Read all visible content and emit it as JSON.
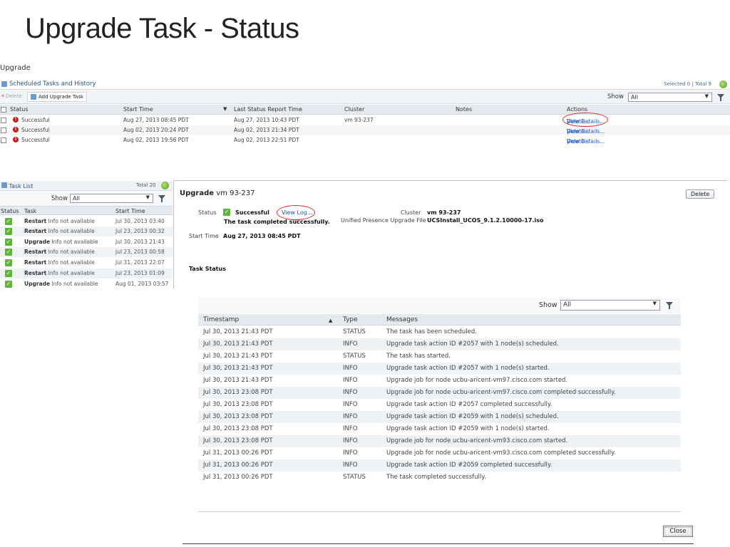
{
  "slide_title": "Upgrade Task - Status",
  "breadcrumb": "Upgrade",
  "scheduled": {
    "title": "Scheduled Tasks and History",
    "counts": "Selected 0 | Total 9",
    "delete_label": "Delete",
    "add_label": "Add Upgrade Task",
    "show_label": "Show",
    "show_value": "All",
    "columns": [
      "Status",
      "Start Time",
      "Last Status Report Time",
      "Cluster",
      "Notes",
      "Actions"
    ],
    "rows": [
      {
        "status": "Successful",
        "start": "Aug 27, 2013 08:45 PDT",
        "last": "Aug 27, 2013 10:43 PDT",
        "cluster": "vm 93-237",
        "notes": "",
        "view": "View Details...",
        "delete": "Delete..."
      },
      {
        "status": "Successful",
        "start": "Aug 02, 2013 20:24 PDT",
        "last": "Aug 02, 2013 21:34 PDT",
        "cluster": "",
        "notes": "",
        "view": "View Details...",
        "delete": "Delete..."
      },
      {
        "status": "Successful",
        "start": "Aug 02, 2013 19:56 PDT",
        "last": "Aug 02, 2013 22:51 PDT",
        "cluster": "",
        "notes": "",
        "view": "View Details...",
        "delete": "Delete..."
      }
    ]
  },
  "task_list": {
    "title": "Task List",
    "total": "Total 20",
    "show_label": "Show",
    "show_value": "All",
    "columns": [
      "Status",
      "Task",
      "Start Time"
    ],
    "rows": [
      {
        "task": "Restart",
        "info": "Info not available",
        "start": "Jul 30, 2013 03:40"
      },
      {
        "task": "Restart",
        "info": "Info not available",
        "start": "Jul 23, 2013 00:32"
      },
      {
        "task": "Upgrade",
        "info": "Info not available",
        "start": "Jul 30, 2013 21:43"
      },
      {
        "task": "Restart",
        "info": "Info not available",
        "start": "Jul 23, 2013 00:58"
      },
      {
        "task": "Restart",
        "info": "Info not available",
        "start": "Jul 31, 2013 22:07"
      },
      {
        "task": "Restart",
        "info": "Info not available",
        "start": "Jul 23, 2013 01:09"
      },
      {
        "task": "Upgrade",
        "info": "Info not available",
        "start": "Aug 01, 2013 03:57"
      }
    ]
  },
  "detail": {
    "title_bold": "Upgrade",
    "title_rest": " vm 93-237",
    "delete_label": "Delete",
    "status_label": "Status",
    "status_value": "Successful",
    "view_log": "View Log...",
    "status_message": "The task completed successfully.",
    "cluster_label": "Cluster",
    "cluster_value": "vm 93-237",
    "file_label": "Unified Presence Upgrade File",
    "file_value": "UCSInstall_UCOS_9.1.2.10000-17.iso",
    "start_label": "Start Time",
    "start_value": "Aug 27, 2013 08:45 PDT",
    "task_status_label": "Task Status"
  },
  "log": {
    "show_label": "Show",
    "show_value": "All",
    "columns": [
      "Timestamp",
      "Type",
      "Messages"
    ],
    "rows": [
      {
        "ts": "Jul 30, 2013 21:43 PDT",
        "type": "STATUS",
        "msg": "The task has been scheduled."
      },
      {
        "ts": "Jul 30, 2013 21:43 PDT",
        "type": "INFO",
        "msg": "Upgrade task action ID #2057 with 1 node(s) scheduled."
      },
      {
        "ts": "Jul 30, 2013 21:43 PDT",
        "type": "STATUS",
        "msg": "The task has started."
      },
      {
        "ts": "Jul 30, 2013 21:43 PDT",
        "type": "INFO",
        "msg": "Upgrade task action ID #2057 with 1 node(s) started."
      },
      {
        "ts": "Jul 30, 2013 21:43 PDT",
        "type": "INFO",
        "msg": "Upgrade job for node ucbu-aricent-vm97.cisco.com started."
      },
      {
        "ts": "Jul 30, 2013 23:08 PDT",
        "type": "INFO",
        "msg": "Upgrade job for node ucbu-aricent-vm97.cisco.com completed successfully."
      },
      {
        "ts": "Jul 30, 2013 23:08 PDT",
        "type": "INFO",
        "msg": "Upgrade task action ID #2057 completed successfully."
      },
      {
        "ts": "Jul 30, 2013 23:08 PDT",
        "type": "INFO",
        "msg": "Upgrade task action ID #2059 with 1 node(s) scheduled."
      },
      {
        "ts": "Jul 30, 2013 23:08 PDT",
        "type": "INFO",
        "msg": "Upgrade task action ID #2059 with 1 node(s) started."
      },
      {
        "ts": "Jul 30, 2013 23:08 PDT",
        "type": "INFO",
        "msg": "Upgrade job for node ucbu-aricent-vm93.cisco.com started."
      },
      {
        "ts": "Jul 31, 2013 00:26 PDT",
        "type": "INFO",
        "msg": "Upgrade job for node ucbu-aricent-vm93.cisco.com completed successfully."
      },
      {
        "ts": "Jul 31, 2013 00:26 PDT",
        "type": "INFO",
        "msg": "Upgrade task action ID #2059 completed successfully."
      },
      {
        "ts": "Jul 31, 2013 00:26 PDT",
        "type": "STATUS",
        "msg": "The task completed successfully."
      }
    ],
    "close_label": "Close"
  },
  "colors": {
    "link": "#1b57c0",
    "error": "#c81d1d",
    "success": "#5fb43a",
    "annotation": "#d82a2a"
  },
  "icons": [
    "refresh-icon",
    "filter-icon",
    "error-icon",
    "success-icon",
    "task-list-icon",
    "sort-asc-icon"
  ]
}
